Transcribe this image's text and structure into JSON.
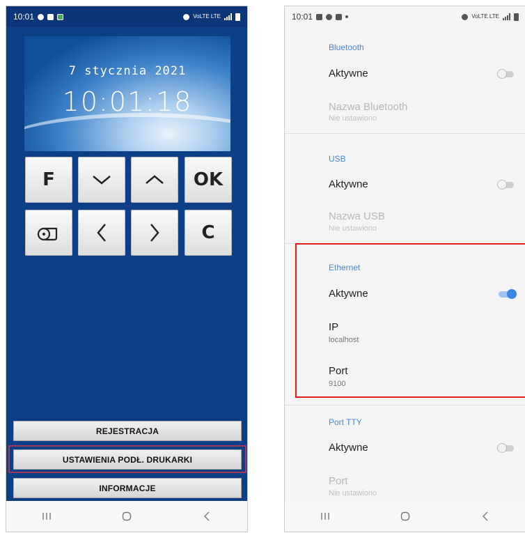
{
  "left_phone": {
    "status": {
      "time": "10:01",
      "network": "VoLTE LTE"
    },
    "clock": {
      "date": "7 stycznia 2021",
      "time": "10:01:18"
    },
    "keys": {
      "f": "F",
      "down": "chevron-down-icon",
      "up": "chevron-up-icon",
      "ok": "OK",
      "paper": "paper-feed-icon",
      "left": "chevron-left-icon",
      "right": "chevron-right-icon",
      "c": "C"
    },
    "menu": {
      "register": "REJESTRACJA",
      "printer_settings": "USTAWIENIA PODŁ. DRUKARKI",
      "info": "INFORMACJE"
    },
    "highlight_color": "#a33a55"
  },
  "right_phone": {
    "status": {
      "time": "10:01",
      "network": "VoLTE LTE"
    },
    "bluetooth": {
      "title": "Bluetooth",
      "active_label": "Aktywne",
      "active": false,
      "name_label": "Nazwa Bluetooth",
      "name_value": "Nie ustawiono"
    },
    "usb": {
      "title": "USB",
      "active_label": "Aktywne",
      "active": false,
      "name_label": "Nazwa USB",
      "name_value": "Nie ustawiono"
    },
    "ethernet": {
      "title": "Ethernet",
      "active_label": "Aktywne",
      "active": true,
      "ip_label": "IP",
      "ip_value": "localhost",
      "port_label": "Port",
      "port_value": "9100"
    },
    "tty": {
      "title": "Port TTY",
      "active_label": "Aktywne",
      "active": false,
      "port_label": "Port",
      "port_value": "Nie ustawiono"
    },
    "highlight_color": "#e31b1b"
  },
  "colors": {
    "app_background": "#0d3f86",
    "accent_blue": "#4a86d8",
    "toggle_on": "#3a85e6"
  }
}
